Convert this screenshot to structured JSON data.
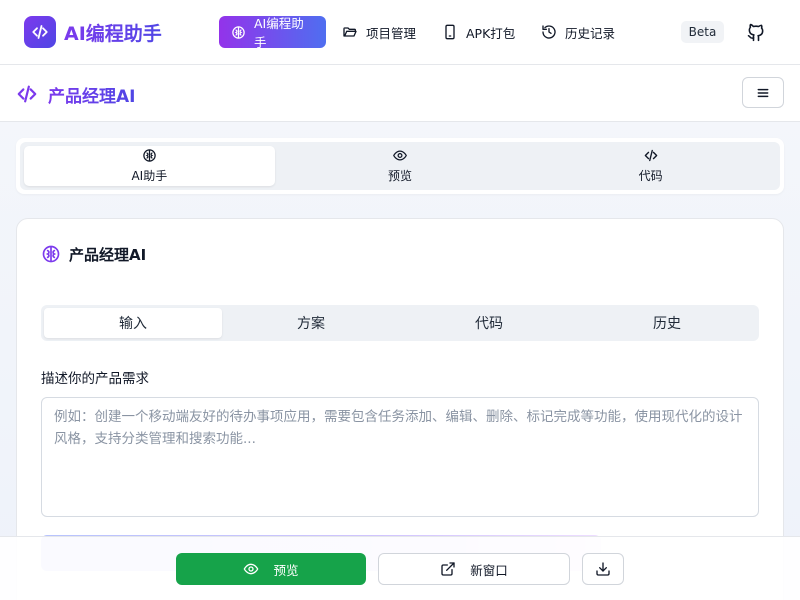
{
  "brand": {
    "name": "AI编程助手"
  },
  "nav": {
    "items": [
      {
        "label": "AI编程助手",
        "icon": "brain-icon",
        "active": true
      },
      {
        "label": "项目管理",
        "icon": "folder-open-icon",
        "active": false
      },
      {
        "label": "APK打包",
        "icon": "smartphone-icon",
        "active": false
      },
      {
        "label": "历史记录",
        "icon": "history-icon",
        "active": false
      }
    ],
    "badge": "Beta",
    "github_icon": "github-icon"
  },
  "subheader": {
    "title": "产品经理AI",
    "icon": "code-icon",
    "menu_icon": "menu-icon"
  },
  "main_tabs": [
    {
      "label": "AI助手",
      "icon": "brain-icon",
      "active": true
    },
    {
      "label": "预览",
      "icon": "eye-icon",
      "active": false
    },
    {
      "label": "代码",
      "icon": "code-icon",
      "active": false
    }
  ],
  "card": {
    "title": "产品经理AI",
    "icon": "brain-icon",
    "tabs": [
      {
        "label": "输入",
        "active": true
      },
      {
        "label": "方案",
        "active": false
      },
      {
        "label": "代码",
        "active": false
      },
      {
        "label": "历史",
        "active": false
      }
    ],
    "field_label": "描述你的产品需求",
    "textarea": {
      "value": "",
      "placeholder": "例如：创建一个移动端友好的待办事项应用，需要包含任务添加、编辑、删除、标记完成等功能，使用现代化的设计风格，支持分类管理和搜索功能..."
    }
  },
  "bottom_bar": {
    "preview_label": "预览",
    "new_window_label": "新窗口",
    "download_icon": "download-icon"
  },
  "colors": {
    "accent_purple": "#7c3aed",
    "accent_indigo": "#4f46e5",
    "preview_green": "#16a34a"
  }
}
